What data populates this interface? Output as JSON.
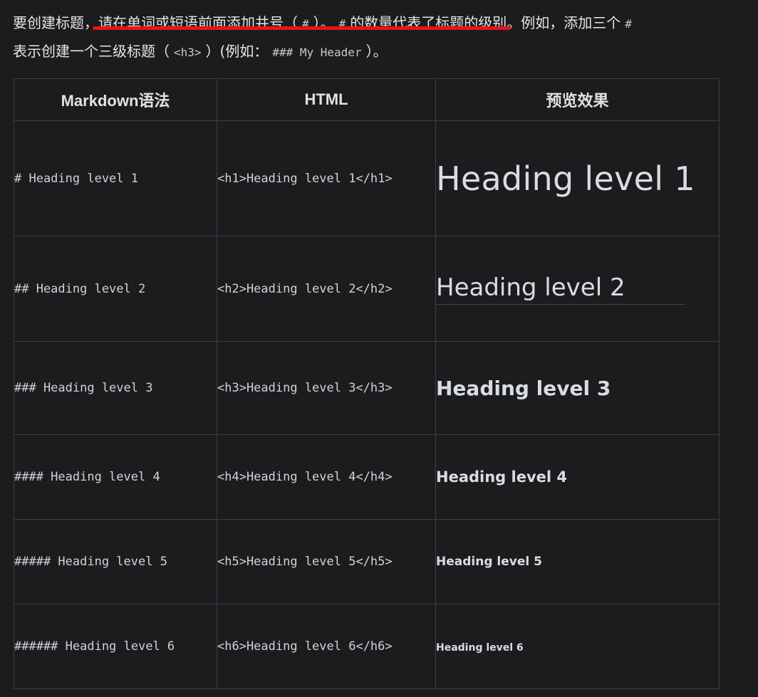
{
  "intro": {
    "l1_a": "要创建标题，",
    "l1_b": "请在单词或短语前面添加井号（",
    "l1_code1": "#",
    "l1_c": "）。",
    "l1_code2": "#",
    "l1_d": "的数量代表了标题的级别",
    "l1_e": "。例如，添加三个",
    "l1_code3": "#",
    "l2_a": "表示创建一个三级标题（",
    "l2_code1": "<h3>",
    "l2_b": "）(例如：",
    "l2_code2": "### My Header",
    "l2_c": "）。"
  },
  "table": {
    "headers": [
      "Markdown语法",
      "HTML",
      "预览效果"
    ],
    "rows": [
      {
        "md": "# Heading level 1",
        "html": "<h1>Heading level 1</h1>",
        "preview": "Heading level 1"
      },
      {
        "md": "## Heading level 2",
        "html": "<h2>Heading level 2</h2>",
        "preview": "Heading level 2"
      },
      {
        "md": "### Heading level 3",
        "html": "<h3>Heading level 3</h3>",
        "preview": "Heading level 3"
      },
      {
        "md": "#### Heading level 4",
        "html": "<h4>Heading level 4</h4>",
        "preview": "Heading level 4"
      },
      {
        "md": "##### Heading level 5",
        "html": "<h5>Heading level 5</h5>",
        "preview": "Heading level 5"
      },
      {
        "md": "###### Heading level 6",
        "html": "<h6>Heading level 6</h6>",
        "preview": "Heading level 6"
      }
    ]
  },
  "colors": {
    "background": "#1c1c1e",
    "border": "#3d3f44",
    "annotation_underline": "#e8141c"
  }
}
